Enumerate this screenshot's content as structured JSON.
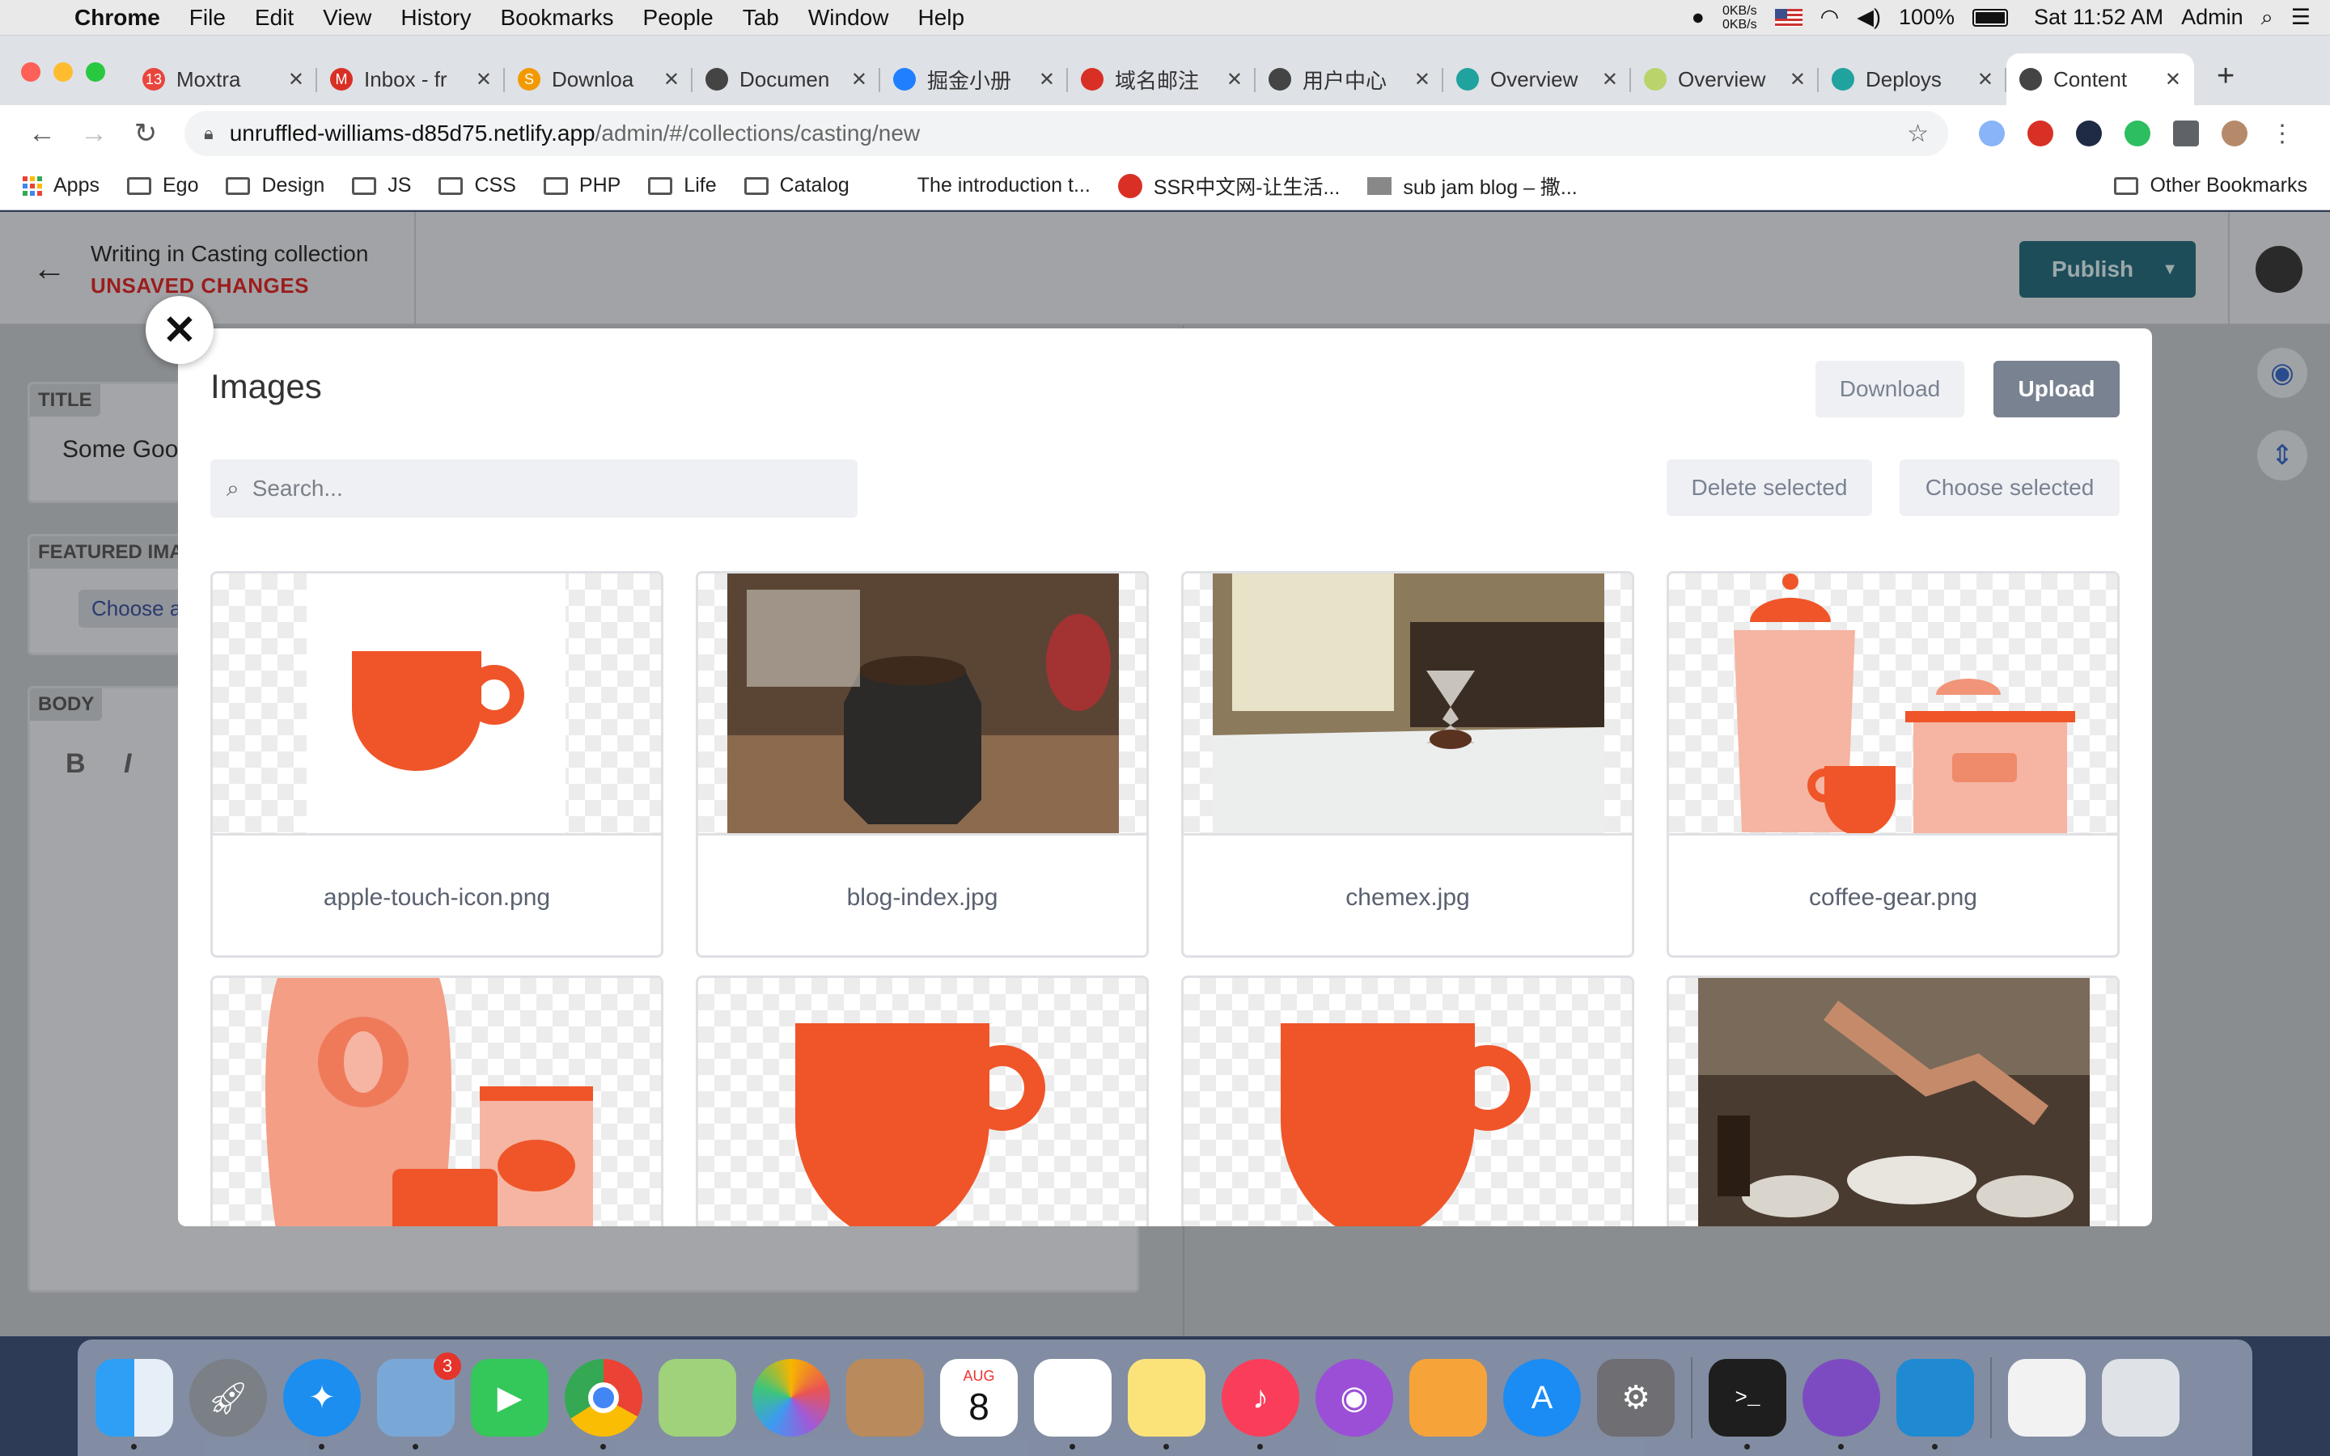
{
  "menubar": {
    "items": [
      "Chrome",
      "File",
      "Edit",
      "View",
      "History",
      "Bookmarks",
      "People",
      "Tab",
      "Window",
      "Help"
    ],
    "net_up": "0KB/s",
    "net_down": "0KB/s",
    "battery": "100%",
    "clock": "Sat 11:52 AM",
    "user": "Admin"
  },
  "tabs": [
    {
      "title": "Moxtra",
      "color": "#e8453c",
      "glyph": "13"
    },
    {
      "title": "Inbox - fr",
      "color": "#d93025",
      "glyph": "M"
    },
    {
      "title": "Downloa",
      "color": "#f29900",
      "glyph": "S"
    },
    {
      "title": "Documen",
      "color": "#444444",
      "glyph": ""
    },
    {
      "title": "掘金小册",
      "color": "#1e80ff",
      "glyph": ""
    },
    {
      "title": "域名邮注",
      "color": "#d93025",
      "glyph": ""
    },
    {
      "title": "用户中心",
      "color": "#444444",
      "glyph": ""
    },
    {
      "title": "Overview",
      "color": "#20a39e",
      "glyph": ""
    },
    {
      "title": "Overview",
      "color": "#b8d46b",
      "glyph": ""
    },
    {
      "title": "Deploys",
      "color": "#20a39e",
      "glyph": ""
    },
    {
      "title": "Content",
      "color": "#444444",
      "glyph": ""
    }
  ],
  "address": {
    "host": "unruffled-williams-d85d75.netlify.app",
    "path": "/admin/#/collections/casting/new"
  },
  "bookmarks": [
    "Apps",
    "Ego",
    "Design",
    "JS",
    "CSS",
    "PHP",
    "Life",
    "Catalog",
    "The introduction t...",
    "SSR中文网-让生活...",
    "sub jam blog – 撒...",
    "Other Bookmarks"
  ],
  "editor": {
    "heading": "Writing in Casting collection",
    "status": "UNSAVED CHANGES",
    "publish_label": "Publish",
    "title_label": "TITLE",
    "title_value": "Some Goo",
    "featured_label": "FEATURED IMA",
    "choose_label": "Choose an",
    "body_label": "BODY",
    "bold_label": "B",
    "italic_label": "I"
  },
  "modal": {
    "title": "Images",
    "download_label": "Download",
    "upload_label": "Upload",
    "search_placeholder": "Search...",
    "delete_label": "Delete selected",
    "choose_label": "Choose selected",
    "close_glyph": "✕",
    "images": [
      {
        "name": "apple-touch-icon.png",
        "kind": "cup-on-white"
      },
      {
        "name": "blog-index.jpg",
        "kind": "photo-coffee-grinder"
      },
      {
        "name": "chemex.jpg",
        "kind": "photo-chemex"
      },
      {
        "name": "coffee-gear.png",
        "kind": "illustration-gear"
      },
      {
        "name": "",
        "kind": "illustration-bags"
      },
      {
        "name": "",
        "kind": "cup-blurred"
      },
      {
        "name": "",
        "kind": "cup-pixelated"
      },
      {
        "name": "",
        "kind": "photo-baristas"
      }
    ]
  },
  "colors": {
    "accent_orange": "#ef5529",
    "publish_bg": "#1e4d5a",
    "unsaved_red": "#9b1d1d"
  },
  "dock": [
    "finder-icon",
    "launchpad-icon",
    "safari-icon",
    "mail-icon",
    "facetime-icon",
    "chrome-icon",
    "maps-icon",
    "photos-icon",
    "contacts-icon",
    "calendar-icon",
    "reminders-icon",
    "notes-icon",
    "music-icon",
    "podcasts-icon",
    "pages-icon",
    "app-store-icon",
    "system-preferences-icon",
    "terminal-icon",
    "github-desktop-icon",
    "vscode-icon",
    "document-icon",
    "trash-icon"
  ],
  "dock_labels": {
    "mail_badge": "3",
    "calendar_month": "AUG",
    "calendar_day": "8",
    "terminal_prompt": ">_"
  }
}
